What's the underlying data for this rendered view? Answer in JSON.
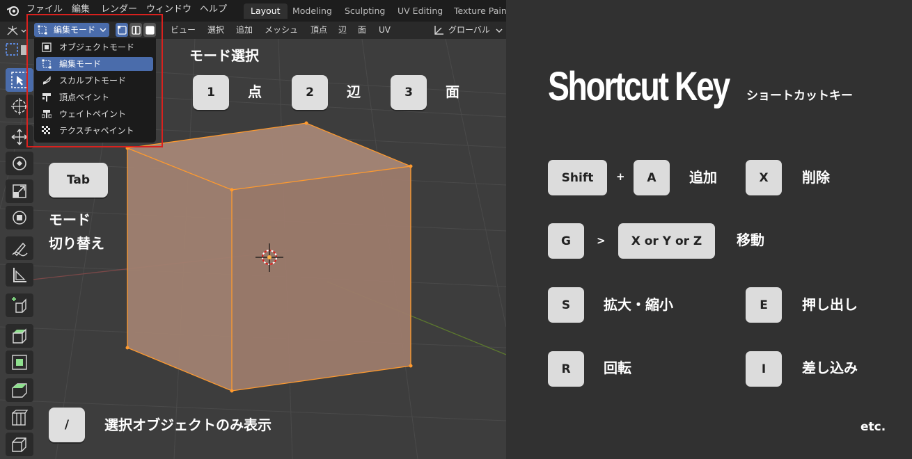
{
  "menubar": {
    "items": [
      "ファイル",
      "編集",
      "レンダー",
      "ウィンドウ",
      "ヘルプ"
    ],
    "workspaces": [
      "Layout",
      "Modeling",
      "Sculpting",
      "UV Editing",
      "Texture Paint"
    ],
    "active_workspace": "Layout"
  },
  "header": {
    "mode_label": "編集モード",
    "menus": [
      "ビュー",
      "選択",
      "追加",
      "メッシュ",
      "頂点",
      "辺",
      "面",
      "UV"
    ],
    "transform_orientation": "グローバル"
  },
  "mode_menu": {
    "items": [
      {
        "label": "オブジェクトモード",
        "icon": "object-mode-icon"
      },
      {
        "label": "編集モード",
        "icon": "edit-mode-icon"
      },
      {
        "label": "スカルプトモード",
        "icon": "sculpt-mode-icon"
      },
      {
        "label": "頂点ペイント",
        "icon": "vertex-paint-icon"
      },
      {
        "label": "ウェイトペイント",
        "icon": "weight-paint-icon"
      },
      {
        "label": "テクスチャペイント",
        "icon": "texture-paint-icon"
      }
    ],
    "selected": "編集モード"
  },
  "tools": [
    "select-box-icon",
    "cursor-icon",
    "move-icon",
    "rotate-icon",
    "scale-icon",
    "transform-icon",
    "annotate-icon",
    "measure-icon",
    "add-cube-icon",
    "extrude-icon",
    "inset-icon",
    "bevel-icon",
    "loop-cut-icon",
    "knife-icon"
  ],
  "viewport_annotations": {
    "mode_select_title": "モード選択",
    "select_keys": [
      {
        "key": "1",
        "label": "点"
      },
      {
        "key": "2",
        "label": "辺"
      },
      {
        "key": "3",
        "label": "面"
      }
    ],
    "tab_key": "Tab",
    "tab_label_line1": "モード",
    "tab_label_line2": "切り替え",
    "slash_key": "/",
    "slash_label": "選択オブジェクトのみ表示"
  },
  "shortcuts": {
    "title": "Shortcut Key",
    "subtitle": "ショートカットキー",
    "rows": {
      "add": {
        "key1": "Shift",
        "op": "+",
        "key2": "A",
        "label": "追加"
      },
      "delete": {
        "key": "X",
        "label": "削除"
      },
      "move": {
        "key1": "G",
        "op": ">",
        "key2": "X or Y or Z",
        "label": "移動"
      },
      "scale": {
        "key": "S",
        "label": "拡大・縮小"
      },
      "extrude": {
        "key": "E",
        "label": "押し出し"
      },
      "rotate": {
        "key": "R",
        "label": "回転"
      },
      "inset": {
        "key": "I",
        "label": "差し込み"
      }
    },
    "etc": "etc."
  },
  "colors": {
    "accent_blue": "#4a6cab",
    "highlight_red": "#d9211e",
    "cube_fill": "#a08272",
    "cube_edge": "#ff9a2e"
  }
}
